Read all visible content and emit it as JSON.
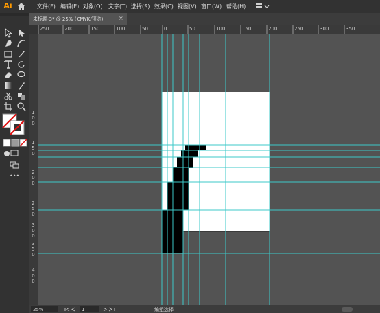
{
  "app": {
    "logo": "Ai",
    "home_icon": "home-icon"
  },
  "menu": [
    {
      "id": "file",
      "label": "文件(F)"
    },
    {
      "id": "edit",
      "label": "编辑(E)"
    },
    {
      "id": "object",
      "label": "对象(O)"
    },
    {
      "id": "type",
      "label": "文字(T)"
    },
    {
      "id": "select",
      "label": "选择(S)"
    },
    {
      "id": "effect",
      "label": "效果(C)"
    },
    {
      "id": "view",
      "label": "视图(V)"
    },
    {
      "id": "window",
      "label": "窗口(W)"
    },
    {
      "id": "help",
      "label": "帮助(H)"
    }
  ],
  "document_tab": {
    "title": "未标题-3* @ 25% (CMYK/预览)",
    "close": "×"
  },
  "ruler_top": [
    "250",
    "200",
    "150",
    "100",
    "50",
    "0",
    "50",
    "100",
    "150",
    "200",
    "250",
    "300",
    "350"
  ],
  "ruler_left": [
    "1",
    "0",
    "0",
    "1",
    "5",
    "0",
    "2",
    "0",
    "0",
    "2",
    "5",
    "0",
    "3",
    "0",
    "0",
    "3",
    "5",
    "0",
    "4",
    "0",
    "0"
  ],
  "toolbar": {
    "more": "•••"
  },
  "status": {
    "zoom": "25%",
    "page": "1",
    "mode": "编组选择"
  },
  "colors": {
    "guide": "#3cc8c8",
    "artboard": "#ffffff",
    "accent": "#ff9a00"
  }
}
